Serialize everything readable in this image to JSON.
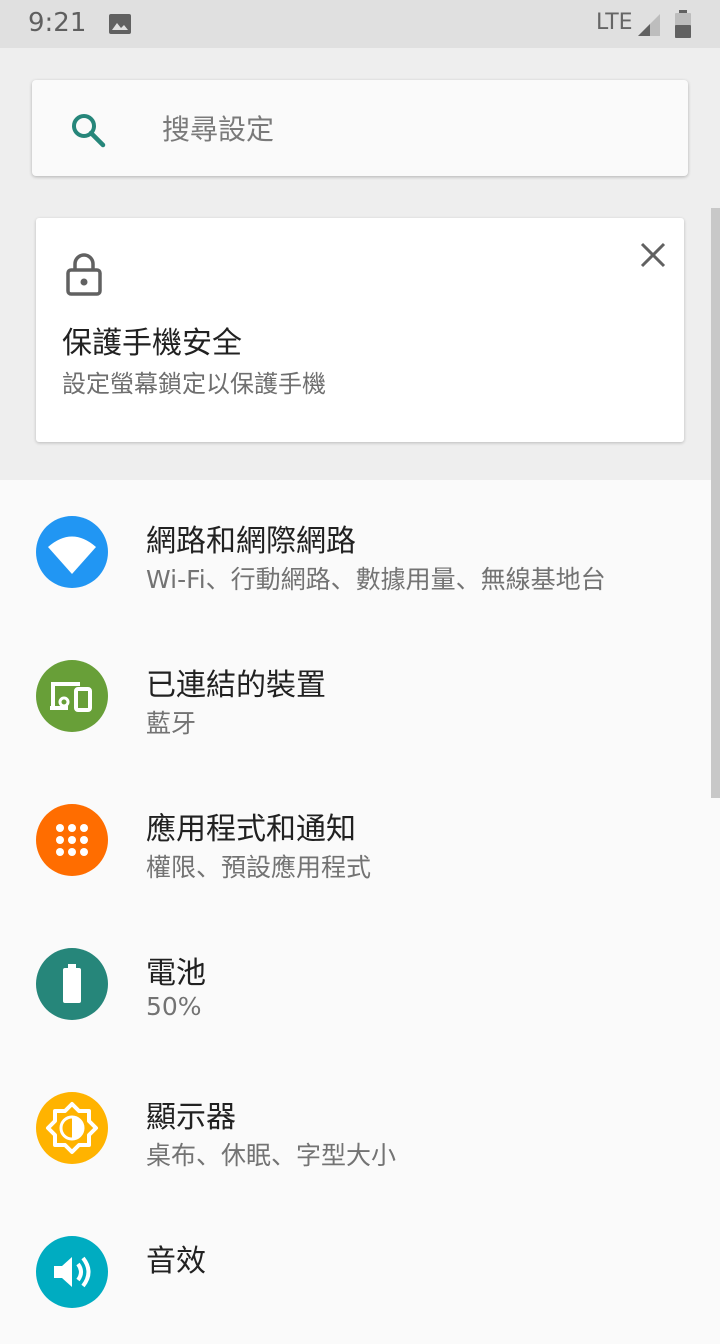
{
  "status_bar": {
    "time": "9:21",
    "network": "LTE"
  },
  "search": {
    "placeholder": "搜尋設定"
  },
  "suggestion_card": {
    "title": "保護手機安全",
    "subtitle": "設定螢幕鎖定以保護手機"
  },
  "settings": [
    {
      "title": "網路和網際網路",
      "subtitle": "Wi-Fi、行動網路、數據用量、無線基地台",
      "icon": "wifi-icon",
      "color": "#2196f3"
    },
    {
      "title": "已連結的裝置",
      "subtitle": "藍牙",
      "icon": "devices-icon",
      "color": "#689f38"
    },
    {
      "title": "應用程式和通知",
      "subtitle": "權限、預設應用程式",
      "icon": "apps-icon",
      "color": "#ff6d00"
    },
    {
      "title": "電池",
      "subtitle": "50%",
      "icon": "battery-icon",
      "color": "#26867a"
    },
    {
      "title": "顯示器",
      "subtitle": "桌布、休眠、字型大小",
      "icon": "brightness-icon",
      "color": "#ffb300"
    },
    {
      "title": "音效",
      "subtitle": "",
      "icon": "volume-icon",
      "color": "#00acc1"
    }
  ]
}
